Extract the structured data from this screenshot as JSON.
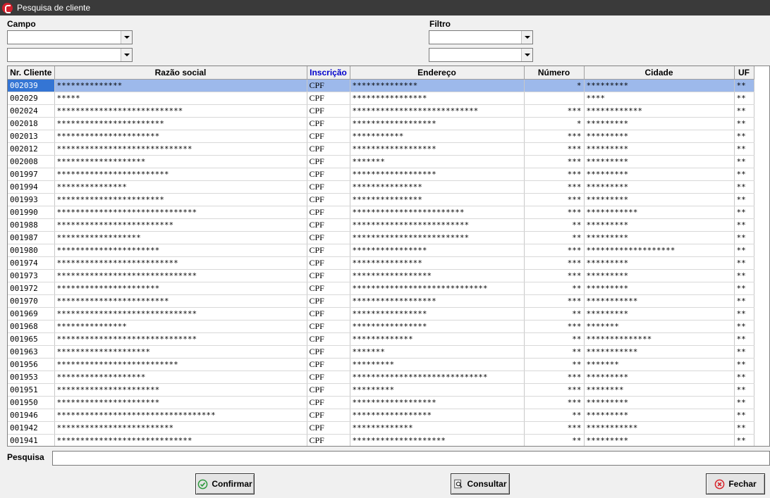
{
  "window": {
    "title": "Pesquisa de cliente"
  },
  "filters": {
    "campo_label": "Campo",
    "filtro_label": "Filtro",
    "campo1": "",
    "campo2": "",
    "filtro1": "",
    "filtro2": ""
  },
  "table": {
    "columns": [
      "Nr. Cliente",
      "Razão social",
      "Inscrição",
      "Endereço",
      "Número",
      "Cidade",
      "UF"
    ],
    "highlighted_column": "Inscrição",
    "selected_row": 0,
    "rows": [
      [
        "002039",
        "**************",
        "CPF",
        "**************",
        "*",
        "*********",
        "**"
      ],
      [
        "002029",
        "*****",
        "CPF",
        "****************",
        "",
        "****",
        "**"
      ],
      [
        "002024",
        "***************************",
        "CPF",
        "***************************",
        "***",
        "************",
        "**"
      ],
      [
        "002018",
        "***********************",
        "CPF",
        "******************",
        "*",
        "*********",
        "**"
      ],
      [
        "002013",
        "**********************",
        "CPF",
        "***********",
        "***",
        "*********",
        "**"
      ],
      [
        "002012",
        "*****************************",
        "CPF",
        "******************",
        "***",
        "*********",
        "**"
      ],
      [
        "002008",
        "*******************",
        "CPF",
        "*******",
        "***",
        "*********",
        "**"
      ],
      [
        "001997",
        "************************",
        "CPF",
        "******************",
        "***",
        "*********",
        "**"
      ],
      [
        "001994",
        "***************",
        "CPF",
        "***************",
        "***",
        "*********",
        "**"
      ],
      [
        "001993",
        "***********************",
        "CPF",
        "***************",
        "***",
        "*********",
        "**"
      ],
      [
        "001990",
        "******************************",
        "CPF",
        "************************",
        "***",
        "***********",
        "**"
      ],
      [
        "001988",
        "*************************",
        "CPF",
        "*************************",
        "**",
        "*********",
        "**"
      ],
      [
        "001987",
        "******************",
        "CPF",
        "*************************",
        "**",
        "*********",
        "**"
      ],
      [
        "001980",
        "**********************",
        "CPF",
        "****************",
        "***",
        "*******************",
        "**"
      ],
      [
        "001974",
        "**************************",
        "CPF",
        "***************",
        "***",
        "*********",
        "**"
      ],
      [
        "001973",
        "******************************",
        "CPF",
        "*****************",
        "***",
        "*********",
        "**"
      ],
      [
        "001972",
        "**********************",
        "CPF",
        "*****************************",
        "**",
        "*********",
        "**"
      ],
      [
        "001970",
        "************************",
        "CPF",
        "******************",
        "***",
        "***********",
        "**"
      ],
      [
        "001969",
        "******************************",
        "CPF",
        "****************",
        "**",
        "*********",
        "**"
      ],
      [
        "001968",
        "***************",
        "CPF",
        "****************",
        "***",
        "*******",
        "**"
      ],
      [
        "001965",
        "******************************",
        "CPF",
        "*************",
        "**",
        "**************",
        "**"
      ],
      [
        "001963",
        "********************",
        "CPF",
        "*******",
        "**",
        "***********",
        "**"
      ],
      [
        "001956",
        "**************************",
        "CPF",
        "*********",
        "**",
        "*******",
        "**"
      ],
      [
        "001953",
        "*******************",
        "CPF",
        "*****************************",
        "***",
        "*********",
        "**"
      ],
      [
        "001951",
        "**********************",
        "CPF",
        "*********",
        "***",
        "********",
        "**"
      ],
      [
        "001950",
        "**********************",
        "CPF",
        "******************",
        "***",
        "*********",
        "**"
      ],
      [
        "001946",
        "**********************************",
        "CPF",
        "*****************",
        "**",
        "*********",
        "**"
      ],
      [
        "001942",
        "*************************",
        "CPF",
        "*************",
        "***",
        "***********",
        "**"
      ],
      [
        "001941",
        "*****************************",
        "CPF",
        "********************",
        "**",
        "*********",
        "**"
      ]
    ]
  },
  "search": {
    "label": "Pesquisa",
    "value": ""
  },
  "buttons": {
    "confirmar": "Confirmar",
    "consultar": "Consultar",
    "fechar": "Fechar"
  },
  "colors": {
    "selection": "#9db9eb",
    "selection_cell": "#3475d4",
    "titlebar": "#3a3a3a",
    "header_highlight": "#0000cc"
  },
  "icons": {
    "app": "app-logo-icon",
    "confirmar": "check-circle-icon",
    "consultar": "search-document-icon",
    "fechar": "close-circle-icon"
  }
}
